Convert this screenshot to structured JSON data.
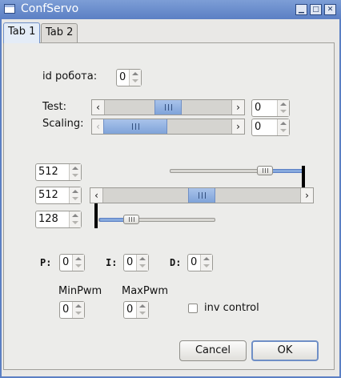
{
  "window": {
    "title": "ConfServo",
    "controls": {
      "minimize": "▁",
      "maximize": "□",
      "close": "✕"
    }
  },
  "tabs": [
    {
      "label": "Tab 1"
    },
    {
      "label": "Tab 2"
    }
  ],
  "robot_id": {
    "label": "id робота:",
    "value": "0"
  },
  "test": {
    "label": "Test:",
    "spin_value": "0"
  },
  "scaling": {
    "label": "Scaling:",
    "spin_value": "0"
  },
  "spins": {
    "upper": "512",
    "middle": "512",
    "lower": "128"
  },
  "pid": {
    "p_label": "P:",
    "p_value": "0",
    "i_label": "I:",
    "i_value": "0",
    "d_label": "D:",
    "d_value": "0"
  },
  "pwm": {
    "min_label": "MinPwm",
    "min_value": "0",
    "max_label": "MaxPwm",
    "max_value": "0"
  },
  "inv_control": {
    "label": "inv control",
    "checked": false
  },
  "buttons": {
    "cancel": "Cancel",
    "ok": "OK"
  },
  "colors": {
    "accent": "#5b7fc4",
    "handle": "#86a9dd",
    "background": "#ececea"
  }
}
